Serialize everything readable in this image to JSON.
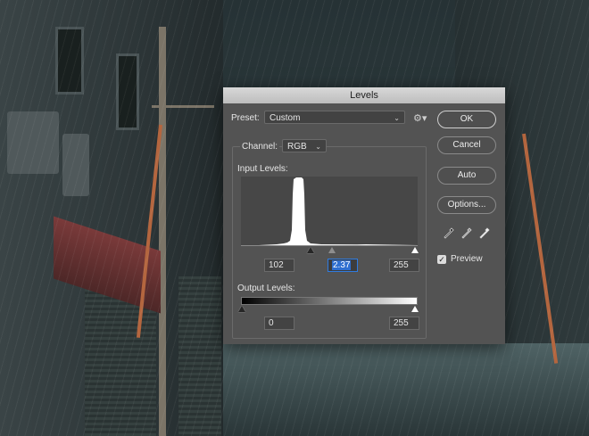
{
  "dialog": {
    "title": "Levels",
    "preset_label": "Preset:",
    "preset_value": "Custom",
    "channel_label": "Channel:",
    "channel_value": "RGB",
    "input_levels_label": "Input Levels:",
    "input_black": "102",
    "input_gamma": "2.37",
    "input_white": "255",
    "output_levels_label": "Output Levels:",
    "output_black": "0",
    "output_white": "255"
  },
  "buttons": {
    "ok": "OK",
    "cancel": "Cancel",
    "auto": "Auto",
    "options": "Options..."
  },
  "preview": {
    "label": "Preview",
    "checked": true
  },
  "icons": [
    "gear-icon",
    "chevron-down-icon",
    "eyedropper-black-icon",
    "eyedropper-gray-icon",
    "eyedropper-white-icon",
    "checkmark-icon"
  ],
  "colors": {
    "dialog_bg": "#535353",
    "selection_blue": "#2f6fd0"
  }
}
